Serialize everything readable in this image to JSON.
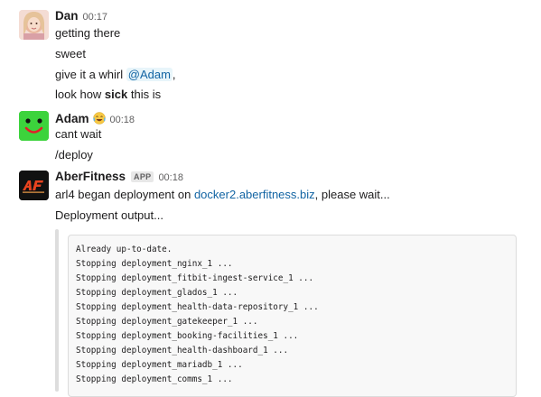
{
  "messages": [
    {
      "sender": "Dan",
      "time": "00:17",
      "lines": [
        "getting there",
        "sweet"
      ],
      "line3_prefix": "give it a whirl ",
      "line3_mention": "@Adam",
      "line3_suffix": ",",
      "line4_prefix": "look how ",
      "line4_bold": "sick",
      "line4_suffix": " this is",
      "avatar_icon": "woman-avatar"
    },
    {
      "sender": "Adam",
      "time": "00:18",
      "status_emoji": "crying-laughing-emoji",
      "lines": [
        "cant wait",
        "/deploy"
      ],
      "avatar_icon": "green-smiley-avatar",
      "avatar_color": "#3cd33c"
    },
    {
      "sender": "AberFitness",
      "badge": "APP",
      "time": "00:18",
      "line1_prefix": "arl4 began deployment on ",
      "line1_link": "docker2.aberfitness.biz",
      "line1_suffix": ", please wait...",
      "line2": "Deployment output...",
      "avatar_icon": "aberfitness-logo",
      "avatar_logo_text": "AF",
      "avatar_color": "#111111",
      "logo_color": "#e8431f"
    }
  ],
  "code_output": [
    "Already up-to-date.",
    "Stopping deployment_nginx_1 ...",
    "Stopping deployment_fitbit-ingest-service_1 ...",
    "Stopping deployment_glados_1 ...",
    "Stopping deployment_health-data-repository_1 ...",
    "Stopping deployment_gatekeeper_1 ...",
    "Stopping deployment_booking-facilities_1 ...",
    "Stopping deployment_health-dashboard_1 ...",
    "Stopping deployment_mariadb_1 ...",
    "Stopping deployment_comms_1 ..."
  ],
  "colors": {
    "link": "#1264a3",
    "text": "#1d1c1d",
    "muted": "#616061"
  }
}
